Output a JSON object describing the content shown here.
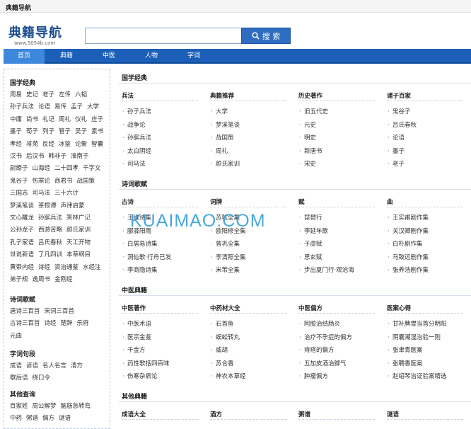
{
  "window": {
    "title": "典籍导航"
  },
  "logo": {
    "text": "典籍导航",
    "sub": "www.5054b.com"
  },
  "search": {
    "placeholder": "",
    "button": "搜 索"
  },
  "nav": {
    "items": [
      "首页",
      "典籍",
      "中医",
      "人物",
      "字词"
    ],
    "active": 0
  },
  "sidebar": {
    "sections": [
      {
        "title": "国学经典",
        "links": [
          "周易",
          "史记",
          "老子",
          "左传",
          "六韬",
          "孙子兵法",
          "论语",
          "易传",
          "孟子",
          "大学",
          "中庸",
          "尚书",
          "礼记",
          "周礼",
          "仪礼",
          "庄子",
          "墨子",
          "荀子",
          "列子",
          "管子",
          "吴子",
          "素书",
          "孝经",
          "将苑",
          "反经",
          "冰鉴",
          "论衡",
          "智囊",
          "汉书",
          "后汉书",
          "韩非子",
          "淮南子",
          "尉缭子",
          "山海经",
          "二十四孝",
          "千字文",
          "鬼谷子",
          "伤寒论",
          "商君书",
          "战国策",
          "三国志",
          "司马法",
          "三十六计",
          "梦溪笔谈",
          "茶根谭",
          "声律启蒙",
          "文心雕龙",
          "孙膑兵法",
          "笑林广记",
          "公孙龙子",
          "西游苦略",
          "颜氏家训",
          "孔子家语",
          "吕氏春秋",
          "天工开物",
          "世说新语",
          "了凡四训",
          "本草纲目",
          "黄帝内经",
          "诗经",
          "资治通鉴",
          "水经注",
          "弟子规",
          "逸周书",
          "金刚经"
        ]
      },
      {
        "title": "诗词歌赋",
        "links": [
          "唐诗三百首",
          "宋词三百首",
          "古诗三百首",
          "诗经",
          "楚辞",
          "乐府",
          "元曲"
        ]
      },
      {
        "title": "字词句段",
        "links": [
          "成语",
          "谚语",
          "名人名言",
          "清方",
          "歇后语",
          "绕口令"
        ]
      },
      {
        "title": "其他查询",
        "links": [
          "百家姓",
          "周公解梦",
          "脑筋急转弯",
          "中药",
          "粥谱",
          "偏方",
          "谜语"
        ]
      }
    ]
  },
  "main": {
    "sections": [
      {
        "title": "国学经典",
        "columns": [
          {
            "head": "兵法",
            "items": [
              "孙子兵法",
              "战争论",
              "孙膑兵法",
              "太白阴经",
              "司马法"
            ]
          },
          {
            "head": "典籍推荐",
            "items": [
              "大学",
              "梦溪笔谈",
              "战国策",
              "周礼",
              "颜氏家训"
            ]
          },
          {
            "head": "历史著作",
            "items": [
              "旧五代史",
              "元史",
              "明史",
              "新唐书",
              "宋史"
            ]
          },
          {
            "head": "诸子百家",
            "items": [
              "鬼谷子",
              "吕氏春秋",
              "论语",
              "墨子",
              "老子"
            ]
          }
        ]
      },
      {
        "title": "诗词歌赋",
        "columns": [
          {
            "head": "古诗",
            "items": [
              "王维诗集",
              "郦驿阳雨",
              "白居易诗集",
              "洞仙歌·行舟已发",
              "李商隐诗集"
            ]
          },
          {
            "head": "词牌",
            "items": [
              "苏轼全集",
              "欧阳修全集",
              "曾巩全集",
              "李清照全集",
              "米芾全集"
            ]
          },
          {
            "head": "赋",
            "items": [
              "琵琶行",
              "李延年歌",
              "子虚赋",
              "思玄赋",
              "步出夏门行·观沧海"
            ]
          },
          {
            "head": "曲",
            "items": [
              "王实甫剧作集",
              "关汉卿剧作集",
              "白朴剧作集",
              "马致远剧作集",
              "张养浩剧作集"
            ]
          }
        ]
      },
      {
        "title": "中医典籍",
        "columns": [
          {
            "head": "中医著作",
            "items": [
              "中医术语",
              "医宗金鉴",
              "千金方",
              "药性歌括四百味",
              "伤寒杂病论"
            ]
          },
          {
            "head": "中药材大全",
            "items": [
              "石首鱼",
              "蜈蚣转丸",
              "威胡",
              "苏合香",
              "神农本草经"
            ]
          },
          {
            "head": "中医偏方",
            "items": [
              "阿胶治结肠炎",
              "治疗不孕症的偏方",
              "痔疮的偏方",
              "五加皮酒治脚气",
              "肿瘤偏方"
            ]
          },
          {
            "head": "医案心得",
            "items": [
              "甘补脾胃当首分明阳",
              "阴囊潮湿治验一则",
              "张聿青医案",
              "张聘香医案",
              "赵绍琴治证验案精选"
            ]
          }
        ]
      },
      {
        "title": "其他典籍",
        "columns": [
          {
            "head": "成语大全",
            "items": []
          },
          {
            "head": "酒方",
            "items": []
          },
          {
            "head": "粥谱",
            "items": []
          },
          {
            "head": "谜语",
            "items": []
          }
        ]
      }
    ]
  },
  "watermark": "KUAIMAO.COM"
}
